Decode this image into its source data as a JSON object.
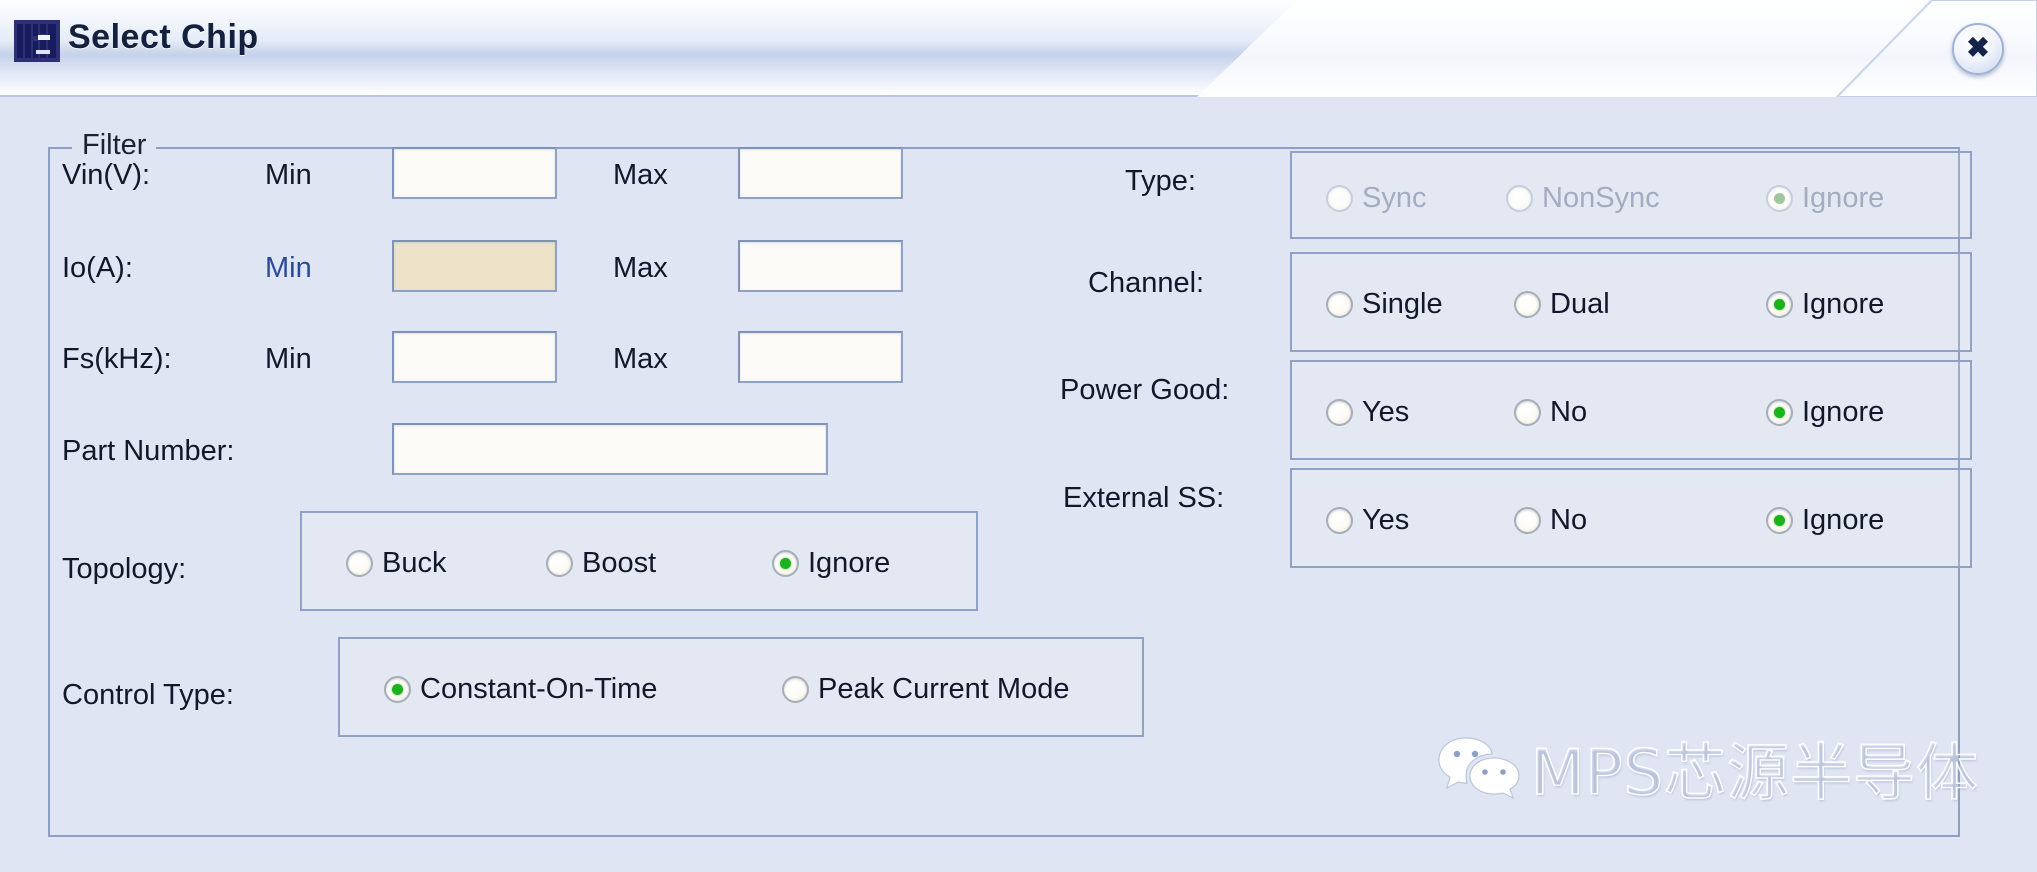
{
  "window": {
    "title": "Select Chip",
    "logo_icon": "mps-logo-icon",
    "close_icon": "close-icon",
    "close_glyph": "✖"
  },
  "filter": {
    "group_title": "Filter",
    "range_rows": [
      {
        "label": "Vin(V):",
        "min_label": "Min",
        "max_label": "Max",
        "min_value": "",
        "max_value": "",
        "min_focused": false
      },
      {
        "label": "Io(A):",
        "min_label": "Min",
        "max_label": "Max",
        "min_value": "",
        "max_value": "",
        "min_focused": true
      },
      {
        "label": "Fs(kHz):",
        "min_label": "Min",
        "max_label": "Max",
        "min_value": "",
        "max_value": "",
        "min_focused": false
      }
    ],
    "part_number": {
      "label": "Part Number:",
      "value": "",
      "placeholder": ""
    },
    "topology": {
      "label": "Topology:",
      "options": [
        {
          "label": "Buck",
          "checked": false
        },
        {
          "label": "Boost",
          "checked": false
        },
        {
          "label": "Ignore",
          "checked": true
        }
      ]
    },
    "control_type": {
      "label": "Control Type:",
      "options": [
        {
          "label": "Constant-On-Time",
          "checked": true
        },
        {
          "label": "Peak Current Mode",
          "checked": false
        }
      ]
    },
    "type": {
      "label": "Type:",
      "disabled": true,
      "options": [
        {
          "label": "Sync",
          "checked": false
        },
        {
          "label": "NonSync",
          "checked": false
        },
        {
          "label": "Ignore",
          "checked": true
        }
      ]
    },
    "channel": {
      "label": "Channel:",
      "disabled": false,
      "options": [
        {
          "label": "Single",
          "checked": false
        },
        {
          "label": "Dual",
          "checked": false
        },
        {
          "label": "Ignore",
          "checked": true
        }
      ]
    },
    "power_good": {
      "label": "Power Good:",
      "disabled": false,
      "options": [
        {
          "label": "Yes",
          "checked": false
        },
        {
          "label": "No",
          "checked": false
        },
        {
          "label": "Ignore",
          "checked": true
        }
      ]
    },
    "external_ss": {
      "label": "External SS:",
      "disabled": false,
      "options": [
        {
          "label": "Yes",
          "checked": false
        },
        {
          "label": "No",
          "checked": false
        },
        {
          "label": "Ignore",
          "checked": true
        }
      ]
    }
  },
  "watermark": {
    "icon": "wechat-icon",
    "text": "MPS芯源半导体"
  },
  "colors": {
    "panel_bg": "#dfe5f2",
    "border": "#8fa2c6",
    "title_text": "#13213f",
    "radio_green": "#19b419",
    "focused_field": "#ece3c9",
    "field_bg": "#fcfbf7",
    "blue_label": "#2b4a9c",
    "disabled_text": "#a3adc1"
  }
}
